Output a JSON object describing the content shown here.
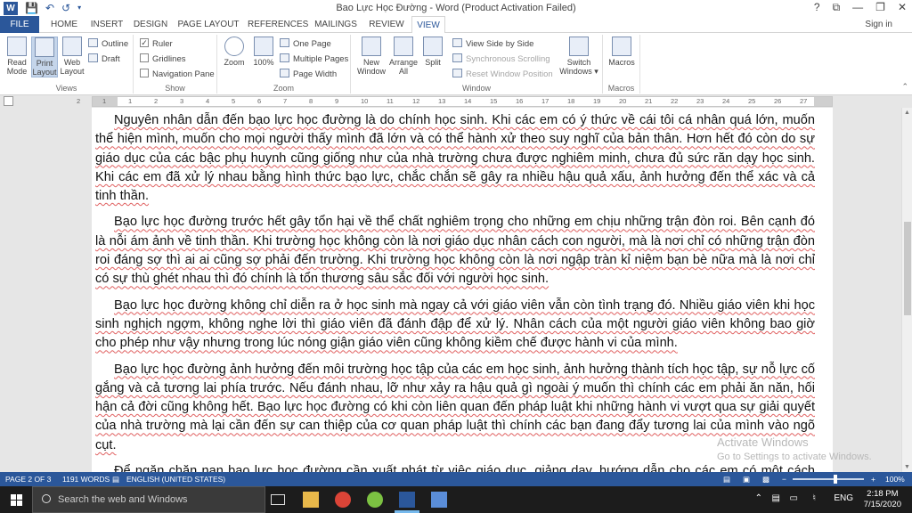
{
  "title_bar": {
    "title": "Bao Lực Học Đường - Word (Product Activation Failed)",
    "help": "?",
    "minimize": "—",
    "restore": "❐",
    "close": "✕",
    "ribbon_display": "⧉"
  },
  "tabs": [
    {
      "label": "FILE"
    },
    {
      "label": "HOME"
    },
    {
      "label": "INSERT"
    },
    {
      "label": "DESIGN"
    },
    {
      "label": "PAGE LAYOUT"
    },
    {
      "label": "REFERENCES"
    },
    {
      "label": "MAILINGS"
    },
    {
      "label": "REVIEW"
    },
    {
      "label": "VIEW"
    }
  ],
  "sign_in": "Sign in",
  "ribbon": {
    "views": {
      "label": "Views",
      "read_mode": "Read Mode",
      "print_layout": "Print Layout",
      "web_layout": "Web Layout",
      "outline": "Outline",
      "draft": "Draft"
    },
    "show": {
      "label": "Show",
      "ruler": "Ruler",
      "gridlines": "Gridlines",
      "navigation_pane": "Navigation Pane",
      "ruler_checked": "✓"
    },
    "zoom": {
      "label": "Zoom",
      "zoom": "Zoom",
      "hundred": "100%",
      "one_page": "One Page",
      "multiple_pages": "Multiple Pages",
      "page_width": "Page Width"
    },
    "window": {
      "label": "Window",
      "new_window": "New Window",
      "arrange_all": "Arrange All",
      "split": "Split",
      "view_side_by_side": "View Side by Side",
      "synchronous_scrolling": "Synchronous Scrolling",
      "reset_window_position": "Reset Window Position",
      "switch_windows": "Switch Windows ▾"
    },
    "macros": {
      "label": "Macros",
      "macros": "Macros"
    }
  },
  "ruler_numbers": [
    "2",
    "1",
    "1",
    "2",
    "3",
    "4",
    "5",
    "6",
    "7",
    "8",
    "9",
    "10",
    "11",
    "12",
    "13",
    "14",
    "15",
    "16",
    "17",
    "18",
    "19",
    "20",
    "21",
    "22",
    "23",
    "24",
    "25",
    "26",
    "27"
  ],
  "document": {
    "paragraphs": [
      "Nguyên nhân dẫn đến bạo lực học đường là do chính học sinh. Khi các em có ý thức về cái tôi cá nhân quá lớn, muốn thể hiện mình, muốn cho mọi người thấy mình đã lớn và có thể hành xử theo suy nghĩ của bản thân. Hơn hết đó còn do sự giáo dục của các bậc phụ huynh cũng giống như của nhà trường chưa được nghiêm minh, chưa đủ sức răn dạy học sinh. Khi các em đã xử lý nhau bằng hình thức bạo lực, chắc chắn sẽ gây ra nhiều hậu quả xấu, ảnh hưởng đến thể xác và cả tinh thần.",
      "Bạo lực học đường trước hết gây tổn hại về thể chất nghiêm trọng cho những em chịu những trận đòn roi. Bên cạnh đó là nỗi ám ảnh về tinh thần. Khi trường học không còn là nơi giáo dục nhân cách con người, mà là nơi chỉ có những trận đòn roi đáng sợ thì ai ai cũng sợ phải đến trường. Khi trường học không còn là nơi ngập tràn kỉ niệm bạn bè nữa mà là nơi chỉ có sự thù ghét nhau thì đó chính là tổn thương sâu sắc đối với người học sinh.",
      "Bạo lực học đường không chỉ diễn ra ở học sinh mà ngay cả với giáo viên vẫn còn tình trạng đó. Nhiều giáo viên khi học sinh nghịch ngợm, không nghe lời thì giáo viên đã đánh đập để xử lý. Nhân cách của một người giáo viên không bao giờ cho phép như vậy nhưng trong lúc nóng giận giáo viên cũng không kiềm chế được hành vi của mình.",
      "Bạo lực học đường ảnh hưởng đến môi trường học tập của các em học sinh, ảnh hưởng thành tích học tập, sự nỗ lực cố gắng và cả tương lai phía trước. Nếu đánh nhau, lỡ như xảy ra hậu quả gì ngoài ý muốn thì chính các em phải ăn năn, hối hận cả đời cũng không hết. Bạo lực học đường có khi còn liên quan đến pháp luật khi những hành vi vượt qua sự giải quyết của nhà trường mà lại cần đến sự can thiệp của cơ quan pháp luật thì chính các bạn đang đẩy tương lai của mình vào ngõ cụt.",
      "Để ngăn chặn nạn bạo lực học đường cần xuất phát từ việc giáo dục, giảng dạy, hướng dẫn cho các em có một cách nhìn nhận đúng đắn hơn về nhân cách và kỷ năng sống. Làm thế nào để các em hiểu và tránh xa bạo lực, xây dựng môi trường trong lành hơn."
    ]
  },
  "watermark": {
    "line1": "Activate Windows",
    "line2": "Go to Settings to activate Windows."
  },
  "status_bar": {
    "page": "PAGE 2 OF 3",
    "words": "1191 WORDS",
    "language": "ENGLISH (UNITED STATES)",
    "zoom_minus": "−",
    "zoom_plus": "+",
    "zoom": "100%"
  },
  "taskbar": {
    "search_placeholder": "Search the web and Windows",
    "language": "ENG",
    "time": "2:18 PM",
    "date": "7/15/2020"
  },
  "colors": {
    "word_blue": "#2b579a",
    "spellcheck_red": "#e06060",
    "taskbar": "#1c1c1c"
  }
}
